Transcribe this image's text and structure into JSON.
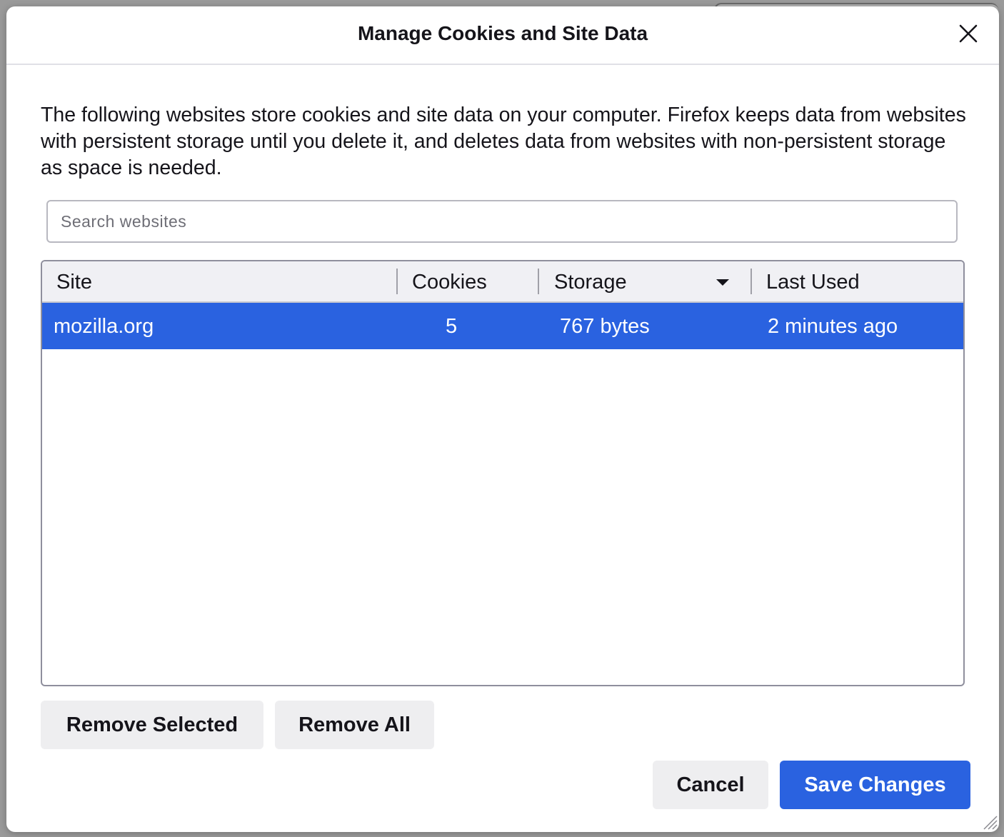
{
  "dialog": {
    "title": "Manage Cookies and Site Data",
    "description": "The following websites store cookies and site data on your computer. Firefox keeps data from websites with persistent storage until you delete it, and deletes data from websites with non-persistent storage as space is needed."
  },
  "search": {
    "placeholder": "Search websites",
    "value": ""
  },
  "table": {
    "columns": [
      "Site",
      "Cookies",
      "Storage",
      "Last Used"
    ],
    "sorted_column": "Storage",
    "rows": [
      {
        "site": "mozilla.org",
        "cookies": "5",
        "storage": "767 bytes",
        "last_used": "2 minutes ago",
        "selected": true
      }
    ]
  },
  "actions": {
    "remove_selected_label": "Remove Selected",
    "remove_all_label": "Remove All",
    "cancel_label": "Cancel",
    "save_label": "Save Changes"
  },
  "icons": {
    "close": "close-icon",
    "sort": "chevron-down-icon",
    "resize": "resize-grip-icon"
  },
  "colors": {
    "accent": "#2a62e0",
    "selection_text": "#ffffff",
    "button_bg": "#eeeef0"
  }
}
